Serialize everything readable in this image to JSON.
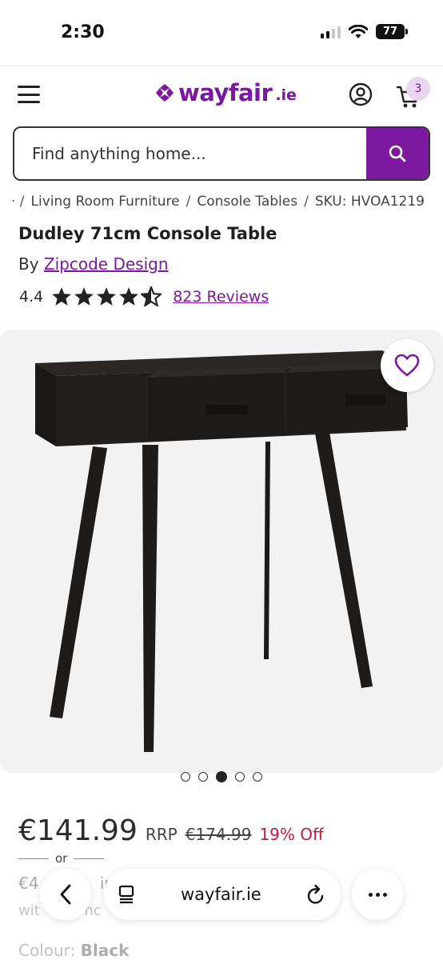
{
  "status_bar": {
    "time": "2:30",
    "battery": "77"
  },
  "header": {
    "logo_text": "wayfair",
    "logo_tld": ".ie",
    "cart_count": "3",
    "brand_color": "#7b189f"
  },
  "search": {
    "placeholder": "Find anything home..."
  },
  "breadcrumb": {
    "items": [
      "Living Room Furniture",
      "Console Tables",
      "SKU: HVOA1219"
    ]
  },
  "product": {
    "title": "Dudley 71cm Console Table",
    "by_label": "By",
    "brand": "Zipcode Design",
    "rating": "4.4",
    "reviews": "823 Reviews",
    "images_count": 5,
    "active_image": 3
  },
  "pricing": {
    "price": "€141.99",
    "rrp_label": "RRP",
    "rrp_value": "€174.99",
    "discount": "19% Off",
    "or_label": "or",
    "finance_partial": "€4",
    "finance_partial2": "ir",
    "finance_line2": "wit",
    "finance_line2b": "nc"
  },
  "colour": {
    "label": "Colour:",
    "value": "Black"
  },
  "browser": {
    "url": "wayfair.ie"
  }
}
